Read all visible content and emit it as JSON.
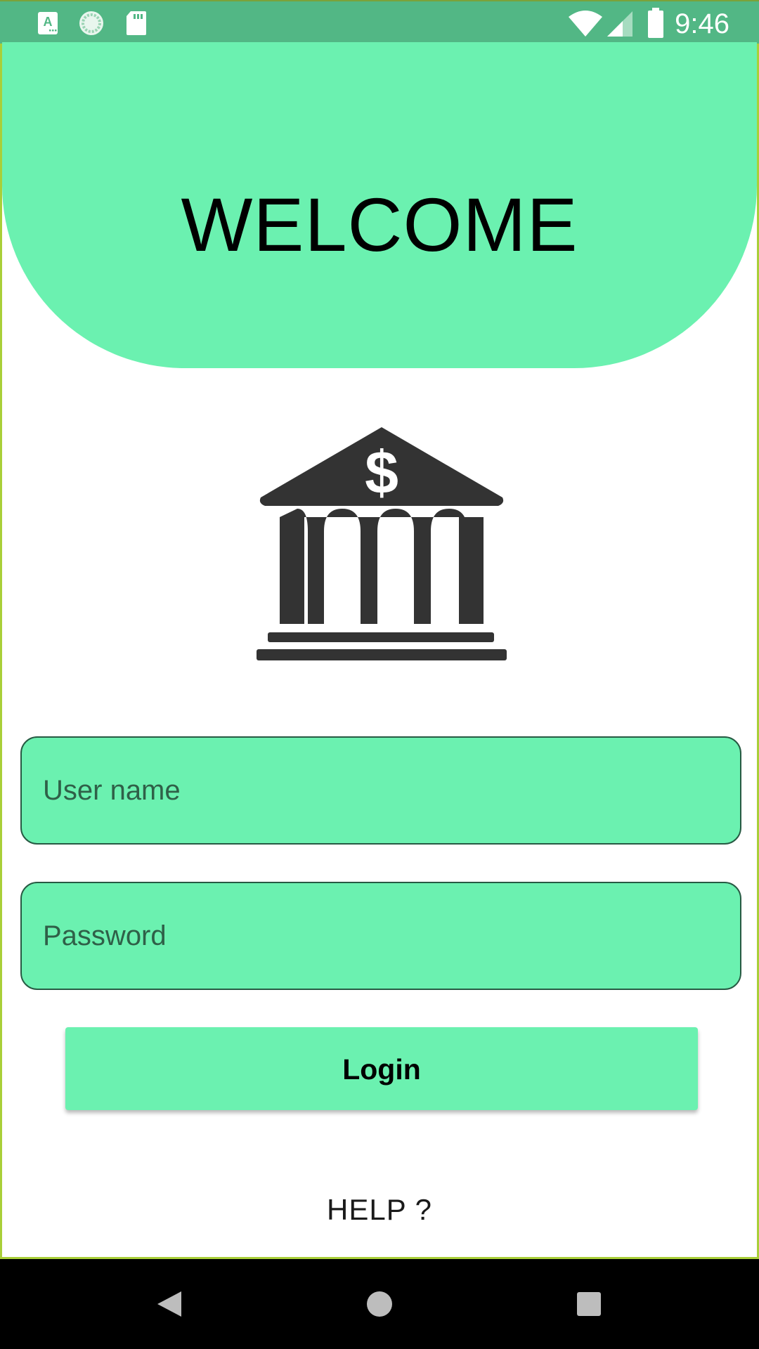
{
  "status_bar": {
    "time": "9:46",
    "icons": [
      "keyboard-app-icon",
      "sync-circle-icon",
      "sd-card-icon",
      "wifi-icon",
      "signal-icon",
      "battery-icon"
    ]
  },
  "header": {
    "title": "WELCOME",
    "background_color": "#6bf1b0"
  },
  "logo": {
    "icon": "bank-icon"
  },
  "form": {
    "username_placeholder": "User name",
    "username_value": "",
    "password_placeholder": "Password",
    "password_value": "",
    "login_label": "Login",
    "help_label": "HELP ?"
  },
  "nav_bar": {
    "buttons": [
      "back-icon",
      "home-icon",
      "recents-icon"
    ]
  },
  "colors": {
    "accent": "#6bf1b0",
    "status_bar": "#52b785",
    "field_border": "#275a43",
    "logo": "#333333"
  }
}
